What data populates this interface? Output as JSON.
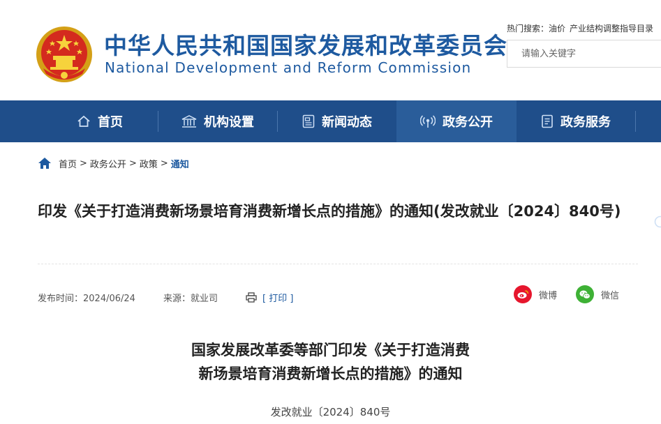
{
  "header": {
    "org_name_cn": "中华人民共和国国家发展和改革委员会",
    "org_name_en": "National Development and Reform Commission",
    "hot_search_label": "热门搜索：",
    "hot_search_items": [
      "油价",
      "产业结构调整指导目录"
    ],
    "search_placeholder": "请输入关键字"
  },
  "nav": {
    "items": [
      {
        "label": "首页",
        "icon": "home-icon"
      },
      {
        "label": "机构设置",
        "icon": "building-icon"
      },
      {
        "label": "新闻动态",
        "icon": "news-icon"
      },
      {
        "label": "政务公开",
        "icon": "broadcast-icon"
      },
      {
        "label": "政务服务",
        "icon": "document-icon"
      }
    ],
    "active_index": 3
  },
  "breadcrumb": {
    "items": [
      "首页",
      "政务公开",
      "政策"
    ],
    "current": "通知",
    "separator": ">"
  },
  "article": {
    "title": "印发《关于打造消费新场景培育消费新增长点的措施》的通知(发改就业〔2024〕840号)",
    "publish_label": "发布时间：",
    "publish_date": "2024/06/24",
    "source_label": "来源：",
    "source": "就业司",
    "print_label": "[ 打印 ]",
    "share": {
      "weibo": "微博",
      "wechat": "微信"
    }
  },
  "body": {
    "title_line1": "国家发展改革委等部门印发《关于打造消费",
    "title_line2": "新场景培育消费新增长点的措施》的通知",
    "doc_number": "发改就业〔2024〕840号"
  },
  "colors": {
    "brand_blue": "#1e5aa0",
    "nav_bg": "#1f4e8a",
    "nav_active": "#2a5d9a",
    "weibo_red": "#e6162d",
    "wechat_green": "#3eb135"
  }
}
